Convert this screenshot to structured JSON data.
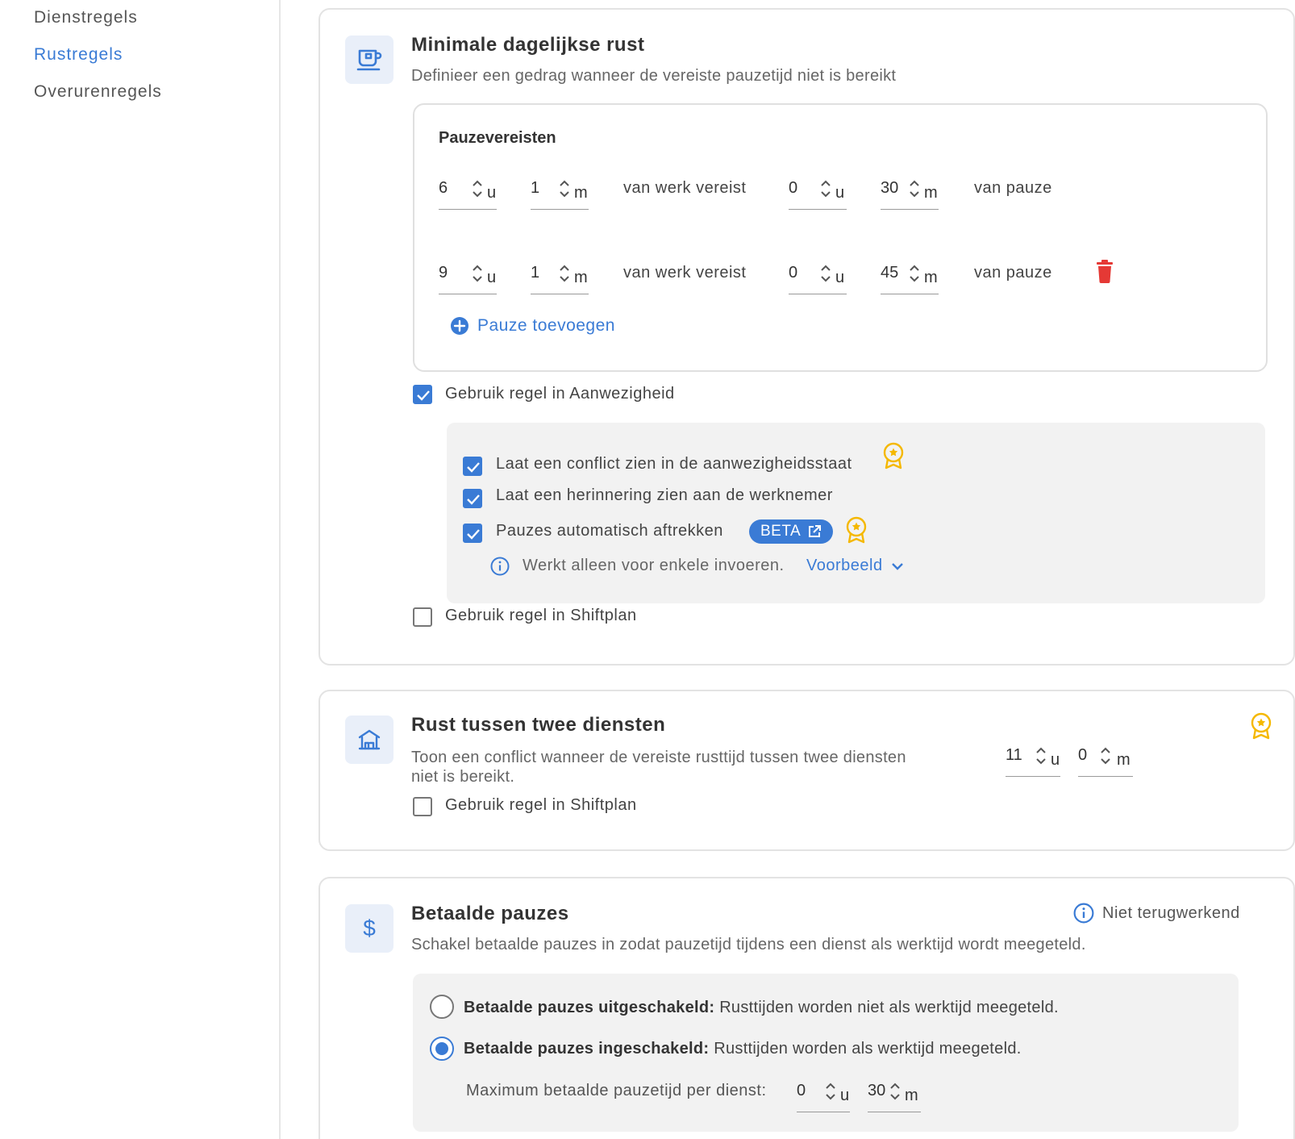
{
  "sidebar": {
    "items": [
      {
        "label": "Dienstregels"
      },
      {
        "label": "Rustregels"
      },
      {
        "label": "Overurenregels"
      }
    ]
  },
  "daily_rest": {
    "title": "Minimale dagelijkse rust",
    "description": "Definieer een gedrag wanneer de vereiste pauzetijd niet is bereikt",
    "requirements_title": "Pauzevereisten",
    "work_label": "van werk vereist",
    "pause_label": "van pauze",
    "unit_hours": "u",
    "unit_minutes": "m",
    "rows": [
      {
        "work_h": "6",
        "work_m": "1",
        "pause_h": "0",
        "pause_m": "30"
      },
      {
        "work_h": "9",
        "work_m": "1",
        "pause_h": "0",
        "pause_m": "45"
      }
    ],
    "add_pause": "Pauze toevoegen",
    "use_in_attendance": "Gebruik regel in Aanwezigheid",
    "show_conflict": "Laat een conflict zien in de aanwezigheidsstaat",
    "show_reminder": "Laat een herinnering zien aan de werknemer",
    "auto_deduct": "Pauzes automatisch aftrekken",
    "beta": "BETA",
    "info_text": "Werkt alleen voor enkele invoeren.",
    "example_link": "Voorbeeld",
    "use_in_shiftplan": "Gebruik regel in Shiftplan"
  },
  "between_shifts": {
    "title": "Rust tussen twee diensten",
    "description": "Toon een conflict wanneer de vereiste rusttijd tussen twee diensten niet is bereikt.",
    "hours": "11",
    "minutes": "0",
    "use_in_shiftplan": "Gebruik regel in Shiftplan"
  },
  "paid_breaks": {
    "title": "Betaalde pauzes",
    "not_retroactive": "Niet terugwerkend",
    "description": "Schakel betaalde pauzes in zodat pauzetijd tijdens een dienst als werktijd wordt meegeteld.",
    "option_off_bold": "Betaalde pauzes uitgeschakeld:",
    "option_off_text": "Rusttijden worden niet als werktijd meegeteld.",
    "option_on_bold": "Betaalde pauzes ingeschakeld:",
    "option_on_text": "Rusttijden worden als werktijd meegeteld.",
    "max_label": "Maximum betaalde pauzetijd per dienst:",
    "max_h": "0",
    "max_m": "30"
  },
  "colors": {
    "accent": "#3a7bd5",
    "delete": "#e53935",
    "premium": "#f5b800"
  }
}
